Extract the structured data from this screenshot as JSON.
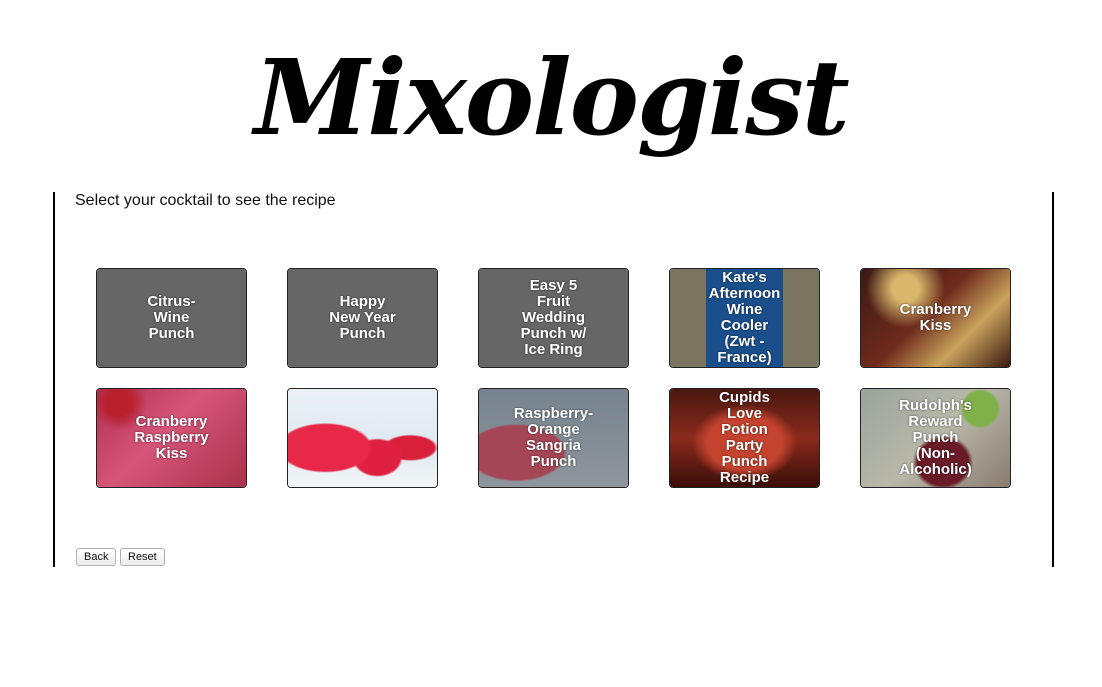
{
  "app": {
    "logo_text": "Mixologist"
  },
  "main": {
    "prompt": "Select your cocktail to see the recipe",
    "cocktails": [
      {
        "label": "Citrus-\nWine\nPunch"
      },
      {
        "label": "Happy\nNew Year\nPunch"
      },
      {
        "label": "Easy 5\nFruit\nWedding\nPunch w/\nIce Ring"
      },
      {
        "label": "Kate's\nAfternoon\nWine\nCooler\n(Zwt -\nFrance)"
      },
      {
        "label": "Cranberry\nKiss"
      },
      {
        "label": "Cranberry\nRaspberry\nKiss"
      },
      {
        "label": ""
      },
      {
        "label": "Raspberry-\nOrange\nSangria\nPunch"
      },
      {
        "label": "Cupids\nLove\nPotion\nParty\nPunch\nRecipe"
      },
      {
        "label": "Rudolph's\nReward\nPunch\n(Non-\nAlcoholic)"
      }
    ]
  },
  "controls": {
    "back_label": "Back",
    "reset_label": "Reset"
  }
}
